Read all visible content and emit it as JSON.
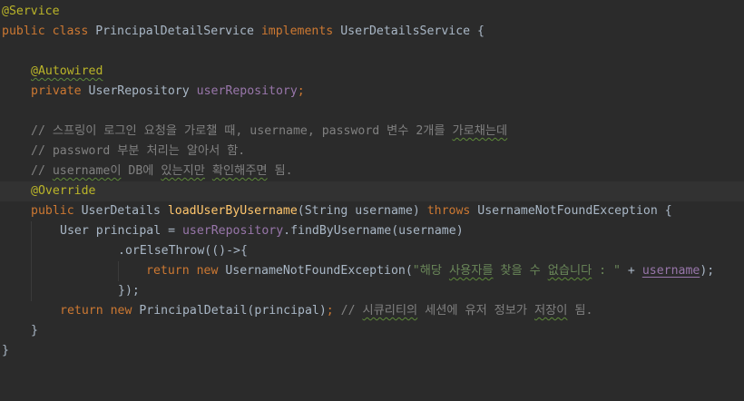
{
  "code": {
    "l1_ann": "@Service",
    "l2_kw1": "public class ",
    "l2_cls": "PrincipalDetailService ",
    "l2_kw2": "implements ",
    "l2_iface": "UserDetailsService {",
    "l4_ann": "@Autowired",
    "l5_kw": "private ",
    "l5_type": "UserRepository ",
    "l5_field": "userRepository",
    "l5_semi": ";",
    "l7_a": "// 스프링이 로그인 요청을 가로챌 때, username, password 변수 2개를 ",
    "l7_b": "가로채는데",
    "l8": "// password 부분 처리는 알아서 함.",
    "l9_a": "// ",
    "l9_b": "username이",
    "l9_c": " DB에 ",
    "l9_d": "있는지만",
    "l9_e": " ",
    "l9_f": "확인해주면",
    "l9_g": " 됨.",
    "l10_ann": "@Override",
    "l11_kw1": "public ",
    "l11_type": "UserDetails ",
    "l11_fn": "loadUserByUsername",
    "l11_params": "(String username) ",
    "l11_kw2": "throws ",
    "l11_exc": "UsernameNotFoundException {",
    "l12_a": "User principal = ",
    "l12_field": "userRepository",
    "l12_b": ".findByUsername(username)",
    "l13": ".orElseThrow(()->{",
    "l14_kw1": "return ",
    "l14_kw2": "new ",
    "l14_exc": "UsernameNotFoundException(",
    "l14_s1": "\"해당 ",
    "l14_s2": "사용자를",
    "l14_s3": " 찾을 수 ",
    "l14_s4": "없습니다",
    "l14_s5": " : \"",
    "l14_plus": " + ",
    "l14_param": "username",
    "l14_end": ");",
    "l15_a": "});",
    "l16_kw1": "return ",
    "l16_kw2": "new ",
    "l16_b": "PrincipalDetail(principal)",
    "l16_semi": "; ",
    "l16_c1": "// ",
    "l16_c2": "시큐리티의",
    "l16_c3": " 세션에 유저 정보가 ",
    "l16_c4": "저장이",
    "l16_c5": " 됨.",
    "l17": "}",
    "l18": "}"
  }
}
